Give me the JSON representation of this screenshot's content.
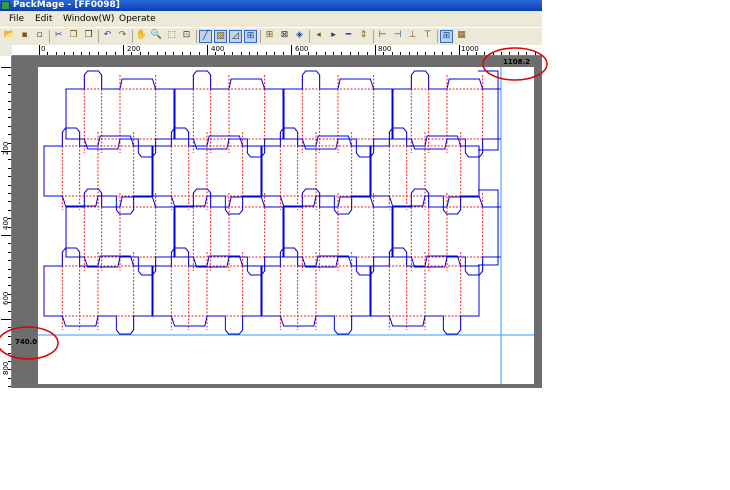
{
  "window": {
    "title": "PackMage - [FF0098]"
  },
  "menu": [
    {
      "label": "File"
    },
    {
      "label": "Edit"
    },
    {
      "label": "Window(W)"
    },
    {
      "label": "Operate"
    }
  ],
  "toolbar": {
    "tools": [
      "open-icon",
      "save-icon",
      "save-as-icon",
      "cut-icon",
      "copy-icon",
      "paste-icon",
      "undo-icon",
      "redo-icon",
      "pan-icon",
      "zoom-icon",
      "select-rect-icon",
      "crop-icon",
      "draw-line-icon",
      "fill-pattern-icon",
      "mirror-icon",
      "align-icon",
      "grid-layout-icon",
      "center-icon",
      "3d-box-icon",
      "step-left-icon",
      "step-right-icon",
      "cut-line-icon",
      "split-icon",
      "fit-left-icon",
      "fit-right-icon",
      "fit-down-icon",
      "fit-up-icon",
      "layout-auto-icon",
      "properties-icon"
    ]
  },
  "ruler": {
    "h_ticks": [
      "0",
      "200",
      "400",
      "600",
      "800",
      "1000"
    ],
    "v_ticks": [
      "200",
      "400",
      "600",
      "800"
    ]
  },
  "readouts": {
    "width": "1108.2",
    "height": "740.0"
  },
  "colors": {
    "cut_line": "#0000dd",
    "crease_line": "#ee2222",
    "guide_line": "#3399ee",
    "highlight_circle": "#dd0000"
  }
}
